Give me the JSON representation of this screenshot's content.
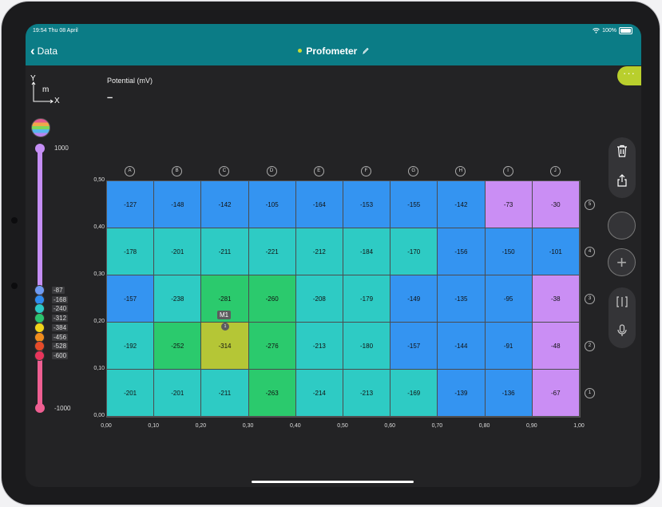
{
  "status": {
    "time": "19:54 Thu 08 April",
    "battery": "100%"
  },
  "nav": {
    "back_label": "Data",
    "title": "Profometer",
    "more_label": "···"
  },
  "axis_glyph": {
    "y": "Y",
    "unit": "m",
    "x": "X"
  },
  "reading": {
    "label": "Potential (mV)",
    "value": "–"
  },
  "scale": {
    "max_label": "1000",
    "min_label": "-1000",
    "levels": [
      {
        "label": "-87",
        "color": "#6f9bf2"
      },
      {
        "label": "-168",
        "color": "#2f8bf0"
      },
      {
        "label": "-240",
        "color": "#2cc9c5"
      },
      {
        "label": "-312",
        "color": "#2cc46f"
      },
      {
        "label": "-384",
        "color": "#f1d31a"
      },
      {
        "label": "-456",
        "color": "#f08c1e"
      },
      {
        "label": "-528",
        "color": "#e64b2a"
      },
      {
        "label": "-600",
        "color": "#e8355c"
      }
    ]
  },
  "palette": {
    "blue": "#3494f1",
    "teal": "#2ecbc4",
    "green": "#2bca6d",
    "olive": "#b5c636",
    "purple": "#ca8ef4"
  },
  "grid": {
    "col_labels": [
      "A",
      "B",
      "C",
      "D",
      "E",
      "F",
      "G",
      "H",
      "I",
      "J"
    ],
    "row_labels": [
      "5",
      "4",
      "3",
      "2",
      "1"
    ],
    "rows": [
      [
        {
          "v": "-127",
          "c": "blue"
        },
        {
          "v": "-148",
          "c": "blue"
        },
        {
          "v": "-142",
          "c": "blue"
        },
        {
          "v": "-105",
          "c": "blue"
        },
        {
          "v": "-164",
          "c": "blue"
        },
        {
          "v": "-153",
          "c": "blue"
        },
        {
          "v": "-155",
          "c": "blue"
        },
        {
          "v": "-142",
          "c": "blue"
        },
        {
          "v": "-73",
          "c": "purple"
        },
        {
          "v": "-30",
          "c": "purple"
        }
      ],
      [
        {
          "v": "-178",
          "c": "teal"
        },
        {
          "v": "-201",
          "c": "teal"
        },
        {
          "v": "-211",
          "c": "teal"
        },
        {
          "v": "-221",
          "c": "teal"
        },
        {
          "v": "-212",
          "c": "teal"
        },
        {
          "v": "-184",
          "c": "teal"
        },
        {
          "v": "-170",
          "c": "teal"
        },
        {
          "v": "-156",
          "c": "blue"
        },
        {
          "v": "-150",
          "c": "blue"
        },
        {
          "v": "-101",
          "c": "blue"
        }
      ],
      [
        {
          "v": "-157",
          "c": "blue"
        },
        {
          "v": "-238",
          "c": "teal"
        },
        {
          "v": "-281",
          "c": "green"
        },
        {
          "v": "-260",
          "c": "green"
        },
        {
          "v": "-208",
          "c": "teal"
        },
        {
          "v": "-179",
          "c": "teal"
        },
        {
          "v": "-149",
          "c": "blue"
        },
        {
          "v": "-135",
          "c": "blue"
        },
        {
          "v": "-95",
          "c": "blue"
        },
        {
          "v": "-38",
          "c": "purple"
        }
      ],
      [
        {
          "v": "-192",
          "c": "teal"
        },
        {
          "v": "-252",
          "c": "green"
        },
        {
          "v": "-314",
          "c": "olive"
        },
        {
          "v": "-276",
          "c": "green"
        },
        {
          "v": "-213",
          "c": "teal"
        },
        {
          "v": "-180",
          "c": "teal"
        },
        {
          "v": "-157",
          "c": "blue"
        },
        {
          "v": "-144",
          "c": "blue"
        },
        {
          "v": "-91",
          "c": "blue"
        },
        {
          "v": "-48",
          "c": "purple"
        }
      ],
      [
        {
          "v": "-201",
          "c": "teal"
        },
        {
          "v": "-201",
          "c": "teal"
        },
        {
          "v": "-211",
          "c": "teal"
        },
        {
          "v": "-263",
          "c": "green"
        },
        {
          "v": "-214",
          "c": "teal"
        },
        {
          "v": "-213",
          "c": "teal"
        },
        {
          "v": "-169",
          "c": "teal"
        },
        {
          "v": "-139",
          "c": "blue"
        },
        {
          "v": "-136",
          "c": "blue"
        },
        {
          "v": "-67",
          "c": "purple"
        }
      ]
    ],
    "x_ticks": [
      "0,00",
      "0,10",
      "0,20",
      "0,30",
      "0,40",
      "0,50",
      "0,60",
      "0,70",
      "0,80",
      "0,90",
      "1,00"
    ],
    "y_ticks": [
      "0,50",
      "0,40",
      "0,30",
      "0,20",
      "0,10",
      "0,00"
    ]
  },
  "marker": {
    "label": "M1",
    "index": "1"
  },
  "side_tools": [
    "trash-icon",
    "share-icon",
    "record-button",
    "add-button",
    "split-view-icon",
    "microphone-icon"
  ]
}
